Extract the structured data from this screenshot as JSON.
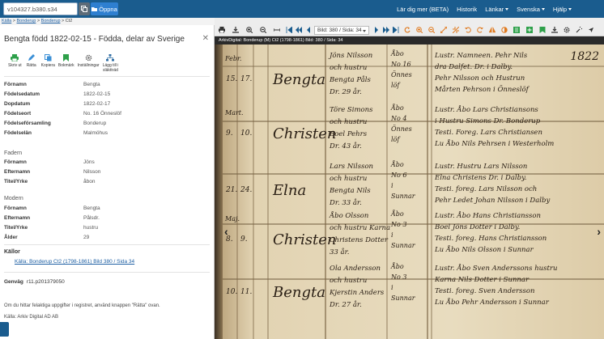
{
  "navbar": {
    "search_value": "v104327.b380.s34",
    "open_label": "Öppna",
    "links": [
      "Lär dig mer (BETA)",
      "Historik",
      "Länkar",
      "Svenska",
      "Hjälp"
    ]
  },
  "breadcrumb": {
    "items": [
      "Källa",
      "Bonderup",
      "Bonderup",
      "Ct2"
    ]
  },
  "panel": {
    "title": "Bengta född 1822-02-15 - Födda, delar av Sverige",
    "toolbar": [
      {
        "label": "Skriv ut",
        "icon": "print-icon",
        "color": "#2ea04a"
      },
      {
        "label": "Rätta",
        "icon": "edit-icon",
        "color": "#3a8fd6"
      },
      {
        "label": "Kopiera",
        "icon": "copy-icon",
        "color": "#3a8fd6"
      },
      {
        "label": "Bokmärk",
        "icon": "bookmark-icon",
        "color": "#2ea04a"
      },
      {
        "label": "Inställningar",
        "icon": "gear-icon",
        "color": "#666666"
      },
      {
        "label": "Lägg till i\nsläktträd",
        "icon": "tree-icon",
        "color": "#2e6da4"
      }
    ],
    "person": [
      {
        "label": "Förnamn",
        "value": "Bengta"
      },
      {
        "label": "Födelsedatum",
        "value": "1822-02-15"
      },
      {
        "label": "Dopdatum",
        "value": "1822-02-17"
      },
      {
        "label": "Födelseort",
        "value": "No. 16 Önneslöf"
      },
      {
        "label": "Födelseförsamling",
        "value": "Bonderup"
      },
      {
        "label": "Födelselän",
        "value": "Malmöhus"
      }
    ],
    "father_title": "Fadern",
    "father": [
      {
        "label": "Förnamn",
        "value": "Jöns"
      },
      {
        "label": "Efternamn",
        "value": "Nilsson"
      },
      {
        "label": "Titel/Yrke",
        "value": "åbon"
      }
    ],
    "mother_title": "Modern",
    "mother": [
      {
        "label": "Förnamn",
        "value": "Bengta"
      },
      {
        "label": "Efternamn",
        "value": "Pålsdr."
      },
      {
        "label": "Titel/Yrke",
        "value": "hustru"
      },
      {
        "label": "Ålder",
        "value": "29"
      }
    ],
    "sources_title": "Källor",
    "source_link": "Källa: Bonderup Ct2 (1798-1861) Bild 380 / Sida 34",
    "genvag_label": "Genväg",
    "genvag_value": "r11.p201379050",
    "footnote": "Om du hittar felaktiga uppgifter i registret, använd knappen \"Rätta\" ovan.",
    "footsource": "Källa: Arkiv Digital AD AB"
  },
  "viewer": {
    "page_select": "Bild: 380 / Sida: 34",
    "caption": "ArkivDigital: Bonderup (M) Ct2 (1798-1861) Bild: 380 / Sida: 34"
  },
  "document": {
    "page_number": "1822",
    "rows": [
      {
        "month": "Febr.",
        "day1": "15.",
        "day2": "17.",
        "name": "Bengta",
        "parents": [
          "Jöns Nilsson",
          "och hustru",
          "Bengta Påls",
          "Dr. 29 år."
        ],
        "place": [
          "Åbo",
          "No 16",
          "Önnes",
          "löf"
        ],
        "witnesses": [
          "Lustr. Namneen. Pehr Nils",
          "dra Dalfet. Dr. i Dalby.",
          "Pehr Nilsson och Hustrun",
          "Mårten Pehrson i Önneslöf"
        ]
      },
      {
        "month": "Mart.",
        "day1": "9.",
        "day2": "10.",
        "name": "Christen",
        "parents": [
          "Töre Simons",
          "och hustru",
          "Boel Pehrs",
          "Dr. 43 år."
        ],
        "place": [
          "Åbo",
          "No 4",
          "Önnes",
          "löf"
        ],
        "witnesses": [
          "Lustr. Åbo Lars Christiansons",
          "i Hustru Simons Dr. Bonderup",
          "Testi. Foreg. Lars Christiansen",
          "Lu Åbo Nils Pehrsen i Westerholm"
        ]
      },
      {
        "month": "",
        "day1": "21.",
        "day2": "24.",
        "name": "Elna",
        "parents": [
          "Lars Nilsson",
          "och hustru",
          "Bengta Nils",
          "Dr. 33 år."
        ],
        "place": [
          "Åbo",
          "No 6",
          "i",
          "Sunnar"
        ],
        "witnesses": [
          "Lustr. Hustru Lars Nilsson",
          "Elna Christens Dr. i Dalby.",
          "Testi. foreg. Lars Nilsson och",
          "Pehr Ledet Johan Nilsson i Dalby"
        ]
      },
      {
        "month": "Maj.",
        "day1": "8.",
        "day2": "9.",
        "name": "Christen",
        "parents": [
          "Åbo Olsson",
          "och hustru Karna",
          "Christens Dotter",
          "33 år."
        ],
        "place": [
          "Åbo",
          "No 3",
          "i",
          "Sunnar"
        ],
        "witnesses": [
          "Lustr. Åbo Hans Christiansson",
          "Boel Jöns Dotter i Dalby.",
          "Testi. foreg. Hans Christiansson",
          "Lu Åbo Nils Olsson i Sunnar"
        ]
      },
      {
        "month": "",
        "day1": "10.",
        "day2": "11.",
        "name": "Bengta",
        "parents": [
          "Ola Andersson",
          "och hustru",
          "Kjerstin Anders",
          "Dr. 27 år."
        ],
        "place": [
          "Åbo",
          "No 3",
          "i",
          "Sunnar"
        ],
        "witnesses": [
          "Lustr. Åbo Sven Anderssons hustru",
          "Karna Nils Dotter i Sunnar",
          "Testi. foreg. Sven Andersson",
          "Lu Åbo Pehr Andersson i Sunnar"
        ]
      }
    ]
  }
}
